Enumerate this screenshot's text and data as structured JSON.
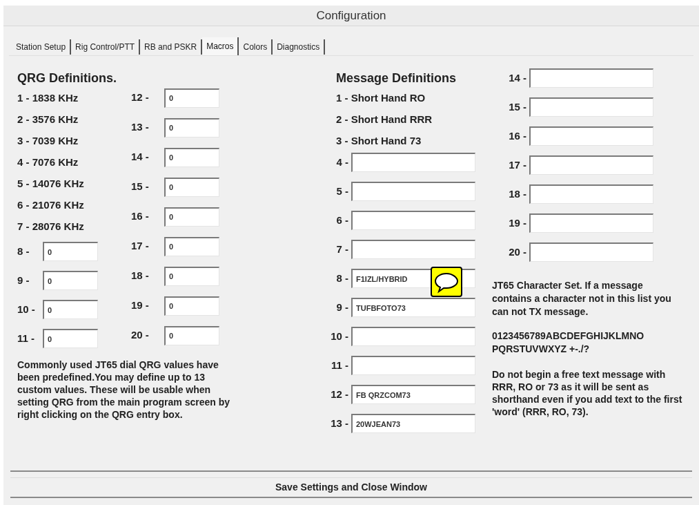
{
  "window": {
    "title": "Configuration"
  },
  "tabs": [
    {
      "label": "Station Setup",
      "selected": false
    },
    {
      "label": "Rig Control/PTT",
      "selected": false
    },
    {
      "label": "RB and PSKR",
      "selected": false
    },
    {
      "label": "Macros",
      "selected": true
    },
    {
      "label": "Colors",
      "selected": false
    },
    {
      "label": "Diagnostics",
      "selected": false
    }
  ],
  "qrg": {
    "title": "QRG Definitions.",
    "presets": [
      "1 - 1838 KHz",
      "2 - 3576 KHz",
      "3 - 7039 KHz",
      "4 - 7076 KHz",
      "5 - 14076 KHz",
      "6 - 21076 KHz",
      "7 - 28076 KHz"
    ],
    "custom_left": [
      {
        "label": "8 -",
        "value": "0"
      },
      {
        "label": "9 -",
        "value": "0"
      },
      {
        "label": "10 -",
        "value": "0"
      },
      {
        "label": "11 -",
        "value": "0"
      }
    ],
    "custom_right": [
      {
        "label": "12 -",
        "value": "0"
      },
      {
        "label": "13 -",
        "value": "0"
      },
      {
        "label": "14 -",
        "value": "0"
      },
      {
        "label": "15 -",
        "value": "0"
      },
      {
        "label": "16 -",
        "value": "0"
      },
      {
        "label": "17 -",
        "value": "0"
      },
      {
        "label": "18 -",
        "value": "0"
      },
      {
        "label": "19 -",
        "value": "0"
      },
      {
        "label": "20 -",
        "value": "0"
      }
    ],
    "note": "Commonly used JT65 dial QRG values have been predefined.You may define up to 13 custom values.  These will be usable when setting QRG from the main program screen by right clicking on the QRG entry box."
  },
  "messages": {
    "title": "Message Definitions",
    "presets": [
      "1 - Short Hand RO",
      "2 - Short Hand RRR",
      "3 - Short Hand 73"
    ],
    "custom_left": [
      {
        "label": "4 -"
      },
      {
        "label": "5 -"
      },
      {
        "label": "6 -"
      },
      {
        "label": "7 -"
      },
      {
        "label": "8 -",
        "value": "F1IZL/HYBRID",
        "comment": true
      },
      {
        "label": "9 -",
        "value": "TUFBFOTO73"
      },
      {
        "label": "10 -"
      },
      {
        "label": "11 -"
      },
      {
        "label": "12 -",
        "value": "FB QRZCOM73"
      },
      {
        "label": "13 -",
        "value": "20WJEAN73"
      }
    ],
    "custom_right": [
      {
        "label": "14 -"
      },
      {
        "label": "15 -"
      },
      {
        "label": "16 -"
      },
      {
        "label": "17 -"
      },
      {
        "label": "18 -"
      },
      {
        "label": "19 -"
      },
      {
        "label": "20 -"
      }
    ]
  },
  "charset": {
    "note": "JT65 Character Set.  If a message contains a character not in this list you can not TX message.",
    "characters": [
      "0123456789ABCDEFGHIJKLMNO",
      "PQRSTUVWXYZ +-./?"
    ],
    "warning": "Do not begin a free text message with RRR, RO or 73 as it will be sent as shorthand even if you add text to the first 'word' (RRR, RO, 73)."
  },
  "save_button": "Save Settings and Close Window"
}
